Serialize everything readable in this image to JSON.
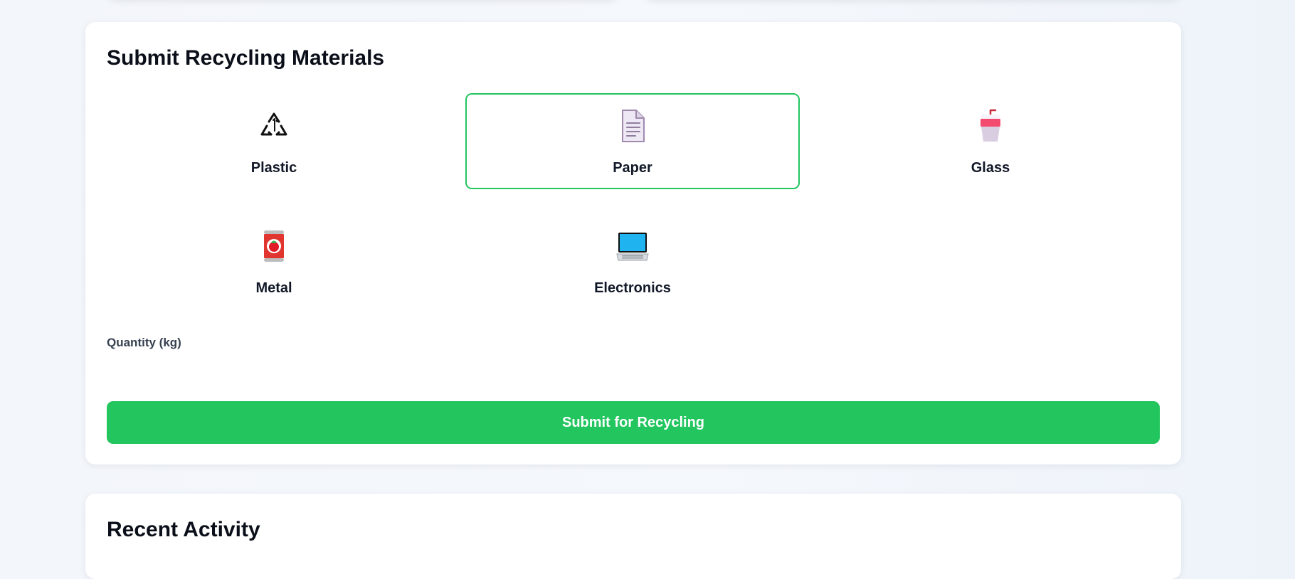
{
  "submit_card": {
    "title": "Submit Recycling Materials",
    "materials": [
      {
        "label": "Plastic",
        "icon": "recycle-icon",
        "selected": false
      },
      {
        "label": "Paper",
        "icon": "document-icon",
        "selected": true
      },
      {
        "label": "Glass",
        "icon": "cup-icon",
        "selected": false
      },
      {
        "label": "Metal",
        "icon": "can-icon",
        "selected": false
      },
      {
        "label": "Electronics",
        "icon": "laptop-icon",
        "selected": false
      }
    ],
    "quantity": {
      "label": "Quantity (kg)",
      "value": "",
      "placeholder": ""
    },
    "submit_label": "Submit for Recycling"
  },
  "activity_card": {
    "title": "Recent Activity"
  },
  "colors": {
    "accent": "#22c55e",
    "background": "#f3f6fb"
  }
}
